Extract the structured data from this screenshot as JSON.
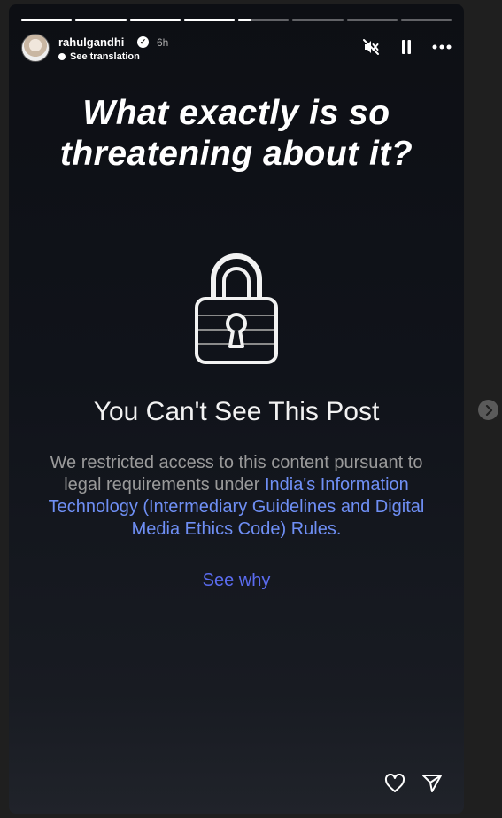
{
  "progress": {
    "segments": [
      1,
      1,
      1,
      1,
      0.25,
      0,
      0,
      0
    ],
    "fill_color": "#ffffff",
    "track_color": "rgba(255,255,255,0.35)"
  },
  "header": {
    "username": "rahulgandhi",
    "verified_icon": "verified-badge-icon",
    "time": "6h",
    "translation_label": "See translation",
    "icons": [
      "mute-icon",
      "pause-icon",
      "more-icon"
    ]
  },
  "story": {
    "headline_line1": "What exactly is so",
    "headline_line2": "threatening about it?",
    "lock_icon": "lock-icon",
    "blocked_title": "You Can't See This Post",
    "desc_plain": "We restricted access to this content pursuant to legal requirements under ",
    "desc_link": "India's Information Technology (Intermediary Guidelines and Digital Media Ethics Code) Rules.",
    "see_why": "See why",
    "link_color": "#6f8ff5"
  },
  "actions": {
    "icons": [
      "heart-icon",
      "send-icon"
    ]
  },
  "navigation": {
    "next_icon": "chevron-right-icon"
  }
}
